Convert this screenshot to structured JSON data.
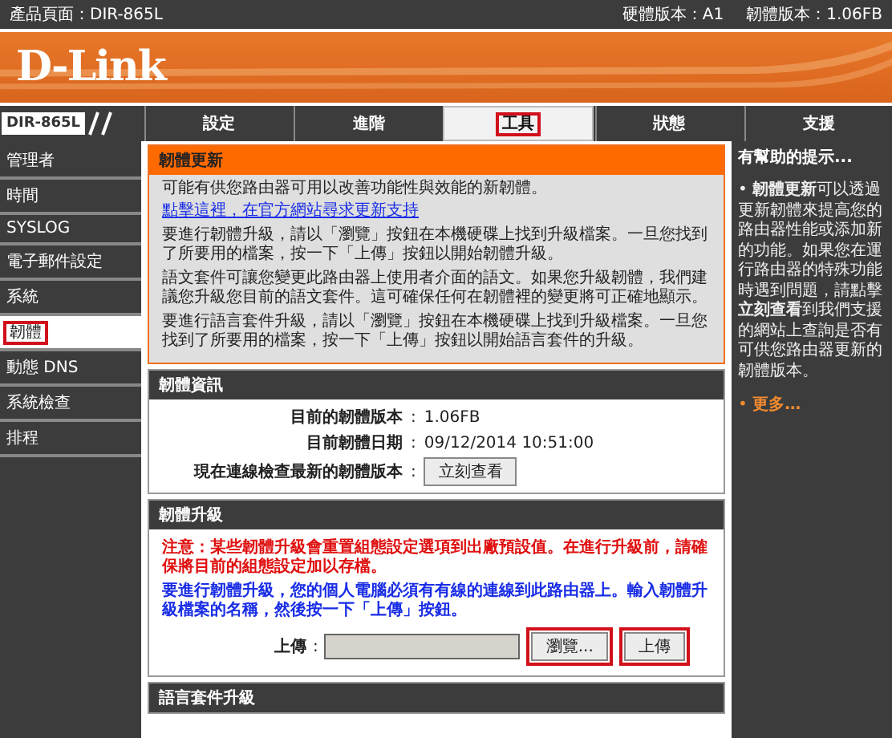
{
  "top_bar": {
    "product": "產品頁面：DIR-865L",
    "hardware": "硬體版本：A1",
    "firmware": "韌體版本：1.06FB"
  },
  "logo": "D-Link",
  "model": "DIR-865L",
  "tabs": [
    {
      "label": "設定",
      "selected": false,
      "highlighted": false
    },
    {
      "label": "進階",
      "selected": false,
      "highlighted": false
    },
    {
      "label": "工具",
      "selected": true,
      "highlighted": true
    },
    {
      "label": "狀態",
      "selected": false,
      "highlighted": false
    },
    {
      "label": "支援",
      "selected": false,
      "highlighted": false
    }
  ],
  "sidebar": {
    "items": [
      {
        "label": "管理者",
        "selected": false,
        "highlighted": false
      },
      {
        "label": "時間",
        "selected": false,
        "highlighted": false
      },
      {
        "label": "SYSLOG",
        "selected": false,
        "highlighted": false
      },
      {
        "label": "電子郵件設定",
        "selected": false,
        "highlighted": false
      },
      {
        "label": "系統",
        "selected": false,
        "highlighted": false
      },
      {
        "label": "韌體",
        "selected": true,
        "highlighted": true
      },
      {
        "label": "動態 DNS",
        "selected": false,
        "highlighted": false
      },
      {
        "label": "系統檢查",
        "selected": false,
        "highlighted": false
      },
      {
        "label": "排程",
        "selected": false,
        "highlighted": false
      }
    ]
  },
  "firmware_update": {
    "title": "韌體更新",
    "intro": "可能有供您路由器可用以改善功能性與效能的新韌體。",
    "link": "點擊這裡，在官方網站尋求更新支持",
    "paragraphs": [
      "要進行韌體升級，請以「瀏覽」按鈕在本機硬碟上找到升級檔案。一旦您找到了所要用的檔案，按一下「上傳」按鈕以開始韌體升級。",
      "語文套件可讓您變更此路由器上使用者介面的語文。如果您升級韌體，我們建議您升級您目前的語文套件。這可確保任何在韌體裡的變更將可正確地顯示。",
      "要進行語言套件升級，請以「瀏覽」按鈕在本機硬碟上找到升級檔案。一旦您找到了所要用的檔案，按一下「上傳」按鈕以開始語言套件的升級。"
    ]
  },
  "firmware_info": {
    "title": "韌體資訊",
    "rows": [
      {
        "kind": "text",
        "label": "目前的韌體版本",
        "colon": ":",
        "value": "1.06FB"
      },
      {
        "kind": "text",
        "label": "目前韌體日期",
        "colon": ":",
        "value": "09/12/2014 10:51:00"
      },
      {
        "kind": "button",
        "label": "現在連線檢查最新的韌體版本",
        "colon": ":",
        "value": "立刻查看"
      }
    ]
  },
  "firmware_upgrade": {
    "title": "韌體升級",
    "warning": "注意：某些韌體升級會重置組態設定選項到出廠預設值。在進行升級前，請確保將目前的組態設定加以存檔。",
    "instruction": "要進行韌體升級，您的個人電腦必須有有線的連線到此路由器上。輸入韌體升級檔案的名稱，然後按一下「上傳」按鈕。",
    "upload_label": "上傳",
    "upload_colon": ":",
    "browse_button": {
      "label": "瀏覽...",
      "highlighted": true
    },
    "upload_button": {
      "label": "上傳",
      "highlighted": true
    }
  },
  "language_upgrade": {
    "title": "語言套件升級"
  },
  "hints": {
    "title": "有幫助的提示...",
    "items": [
      {
        "kind": "text",
        "text": "• **韌體更新**可以透過更新韌體來提高您的路由器性能或添加新的功能。如果您在運行路由器的特殊功能時遇到問題，請點擊**立刻查看**到我們支援的網站上查詢是否有可供您路由器更新的韌體版本。"
      },
      {
        "kind": "link",
        "text": "• **更多…**"
      }
    ]
  }
}
